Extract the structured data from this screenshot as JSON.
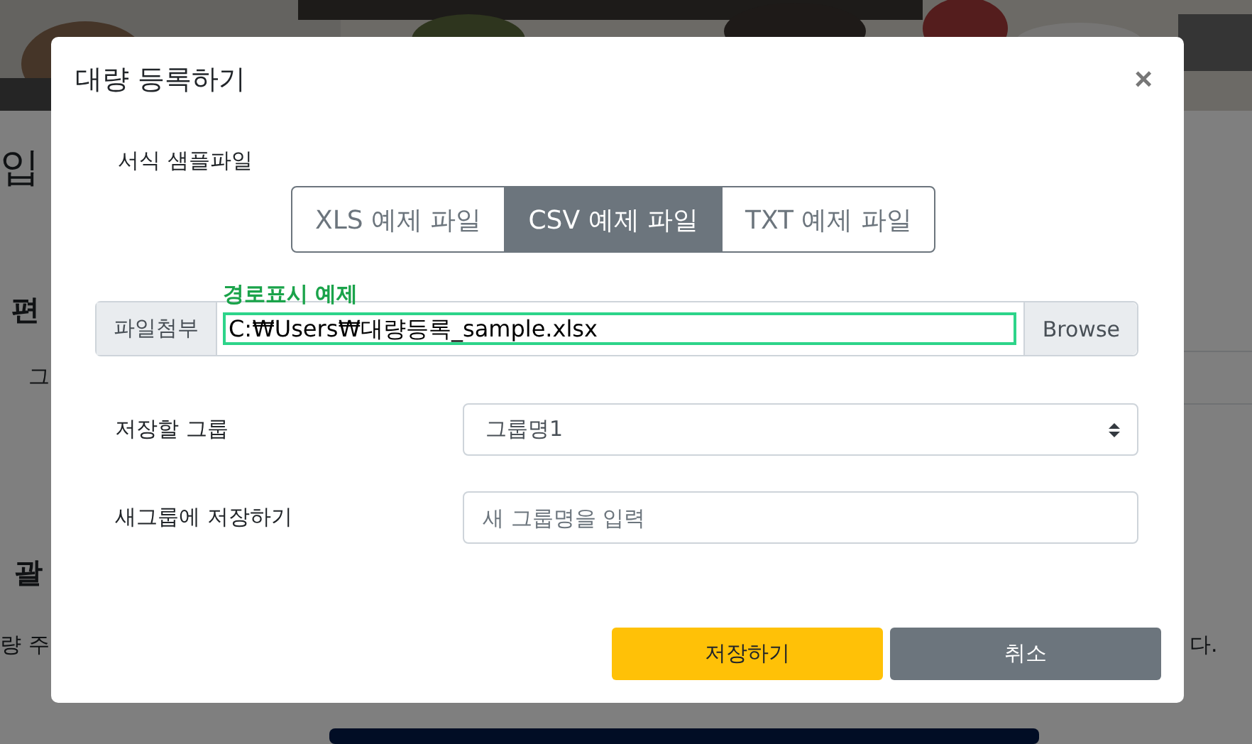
{
  "background": {
    "texts": [
      {
        "kind": "heading",
        "text": "입"
      },
      {
        "kind": "subheading",
        "text": "편"
      },
      {
        "kind": "small",
        "text": "그"
      },
      {
        "kind": "subheading2",
        "text": "괄"
      },
      {
        "kind": "body",
        "text": "량 주"
      },
      {
        "kind": "body_right",
        "text": "다."
      }
    ]
  },
  "modal": {
    "title": "대량 등록하기",
    "close": "×",
    "sample_label": "서식 샘플파일",
    "sample_tabs": [
      {
        "label": "XLS 예제 파일",
        "selected": false
      },
      {
        "label": "CSV 예제 파일",
        "selected": true
      },
      {
        "label": "TXT 예제 파일",
        "selected": false
      }
    ],
    "file": {
      "prefix": "파일첨부",
      "hint": "경로표시 예제",
      "value": "C:₩Users₩대량등록_sample.xlsx",
      "button": "Browse"
    },
    "fields": [
      {
        "kind": "select",
        "label": "저장할 그룹",
        "value": "그룹명1"
      },
      {
        "kind": "input",
        "label": "새그룹에 저장하기",
        "placeholder": "새 그룹명을 입력"
      }
    ],
    "buttons": [
      {
        "kind": "primary",
        "label": "저장하기"
      },
      {
        "kind": "secondary",
        "label": "취소"
      }
    ]
  }
}
